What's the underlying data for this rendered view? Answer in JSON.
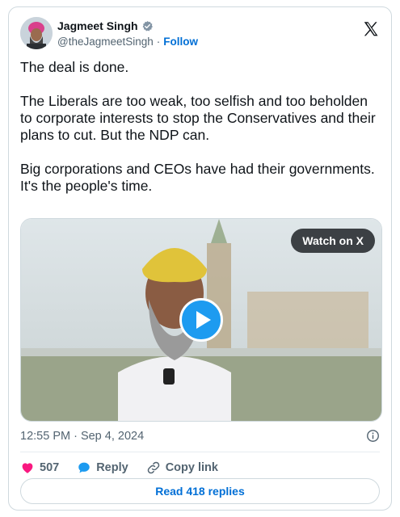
{
  "author": {
    "name": "Jagmeet Singh",
    "handle": "@theJagmeetSingh",
    "separator": "·",
    "follow_label": "Follow"
  },
  "tweet": {
    "text": "The deal is done.\n\nThe Liberals are too weak, too selfish and too beholden to corporate interests to stop the Conservatives and their plans to cut. But the NDP can.\n\nBig corporations and CEOs have had their governments. It's the people's time.",
    "timestamp": "12:55 PM · Sep 4, 2024"
  },
  "media": {
    "watch_label": "Watch on X"
  },
  "actions": {
    "like_count": "507",
    "reply_label": "Reply",
    "copy_link_label": "Copy link"
  },
  "replies_button": "Read 418 replies",
  "colors": {
    "accent": "#006fd6",
    "like": "#f91880",
    "reply_icon": "#1d9bf0",
    "muted": "#536471"
  },
  "icons": {
    "verified": "verified-badge-icon",
    "x_logo": "x-logo-icon",
    "info": "info-icon",
    "like": "heart-icon",
    "reply": "reply-bubble-icon",
    "copy_link": "link-icon",
    "play": "play-icon"
  }
}
